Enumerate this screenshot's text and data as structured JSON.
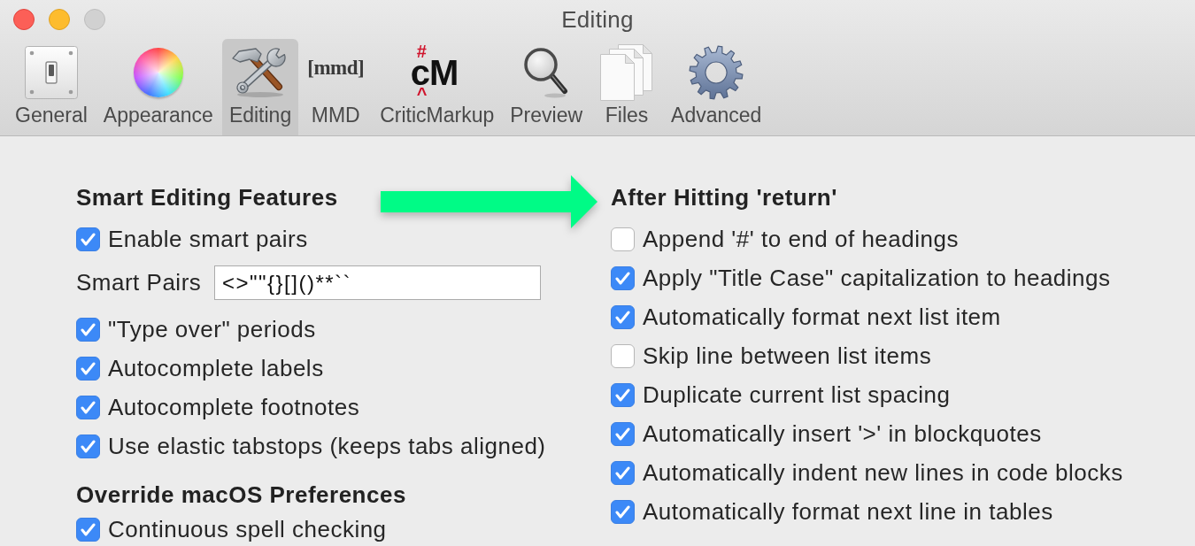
{
  "window": {
    "title": "Editing",
    "controls": [
      {
        "kind": "close",
        "disabled": false
      },
      {
        "kind": "minimize",
        "disabled": false
      },
      {
        "kind": "zoom",
        "disabled": true
      }
    ]
  },
  "tabs": [
    {
      "label": "General",
      "selected": false
    },
    {
      "label": "Appearance",
      "selected": false
    },
    {
      "label": "Editing",
      "selected": true
    },
    {
      "label": "MMD",
      "logo": "[mmd]",
      "selected": false
    },
    {
      "label": "CriticMarkup",
      "logo": "cM",
      "logo_marks": [
        "#",
        "^"
      ],
      "selected": false
    },
    {
      "label": "Preview",
      "selected": false
    },
    {
      "label": "Files",
      "selected": false
    },
    {
      "label": "Advanced",
      "selected": false
    }
  ],
  "left_column": [
    {
      "heading": "Smart Editing Features",
      "items": [
        {
          "kind": "checkbox",
          "label": "Enable smart pairs",
          "checked": true
        },
        {
          "kind": "field",
          "label": "Smart Pairs",
          "value": "<>\"\"{}[]()**``"
        },
        {
          "kind": "checkbox",
          "label": "\"Type over\" periods",
          "checked": true
        },
        {
          "kind": "checkbox",
          "label": "Autocomplete labels",
          "checked": true
        },
        {
          "kind": "checkbox",
          "label": "Autocomplete footnotes",
          "checked": true
        },
        {
          "kind": "checkbox",
          "label": "Use elastic tabstops (keeps tabs aligned)",
          "checked": true
        }
      ]
    },
    {
      "heading": "Override macOS Preferences",
      "items": [
        {
          "kind": "checkbox",
          "label": "Continuous spell checking",
          "checked": true
        }
      ]
    }
  ],
  "right_column": [
    {
      "heading": "After Hitting 'return'",
      "items": [
        {
          "kind": "checkbox",
          "label": "Append '#' to end of headings",
          "checked": false
        },
        {
          "kind": "checkbox",
          "label": "Apply \"Title Case\" capitalization to headings",
          "checked": true
        },
        {
          "kind": "checkbox",
          "label": "Automatically format next list item",
          "checked": true
        },
        {
          "kind": "checkbox",
          "label": "Skip line between list items",
          "checked": false
        },
        {
          "kind": "checkbox",
          "label": "Duplicate current list spacing",
          "checked": true
        },
        {
          "kind": "checkbox",
          "label": "Automatically insert '>' in blockquotes",
          "checked": true
        },
        {
          "kind": "checkbox",
          "label": "Automatically indent new lines in code blocks",
          "checked": true
        },
        {
          "kind": "checkbox",
          "label": "Automatically format next line in tables",
          "checked": true
        }
      ]
    }
  ]
}
